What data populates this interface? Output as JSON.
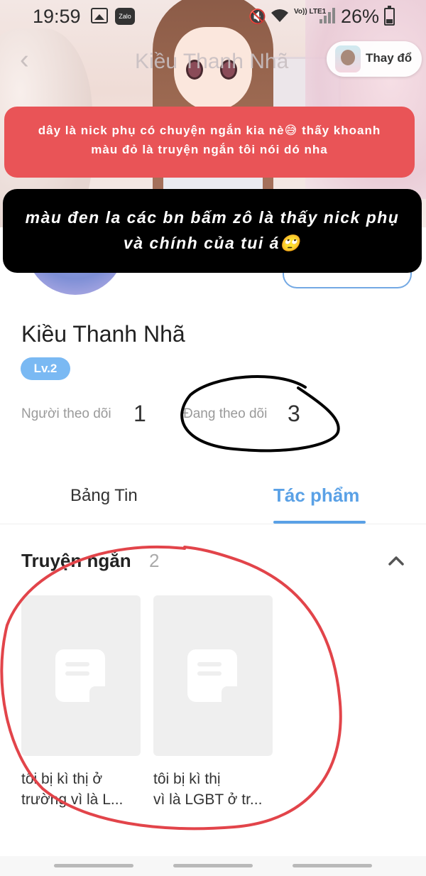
{
  "status_bar": {
    "time": "19:59",
    "notification_icons": [
      "gallery-icon",
      "zalo-icon"
    ],
    "volte_text": "Vo)) LTE1",
    "battery_percent": "26%"
  },
  "header": {
    "title": "Kiều Thanh Nhã",
    "change_label": "Thay đổ"
  },
  "annotations": {
    "red_note": "dây là nick phụ có chuyện ngắn kia nè😅 thấy khoanh màu đỏ là truyện ngắn tôi nói dó nha",
    "black_note": "màu đen la các bn bấm zô là thấy nick phụ và chính của tui á🙄"
  },
  "profile": {
    "name": "Kiều Thanh Nhã",
    "level": "Lv.2",
    "followers_label": "Người theo dõi",
    "followers_count": "1",
    "following_label": "Đang theo dõi",
    "following_count": "3"
  },
  "tabs": [
    {
      "label": "Bảng Tin",
      "active": false
    },
    {
      "label": "Tác phẩm",
      "active": true
    }
  ],
  "section": {
    "title": "Truyện ngắn",
    "count": "2",
    "stories": [
      {
        "title_line1": "tôi bị kì thị ở",
        "title_line2": "trường vì là L..."
      },
      {
        "title_line1": "tôi bị kì thị",
        "title_line2": "vì là LGBT ở tr..."
      }
    ]
  },
  "colors": {
    "accent": "#5aa1e6",
    "red_note_bg": "#e95457",
    "black_note_bg": "#000000",
    "level_badge": "#7ab9f3"
  }
}
